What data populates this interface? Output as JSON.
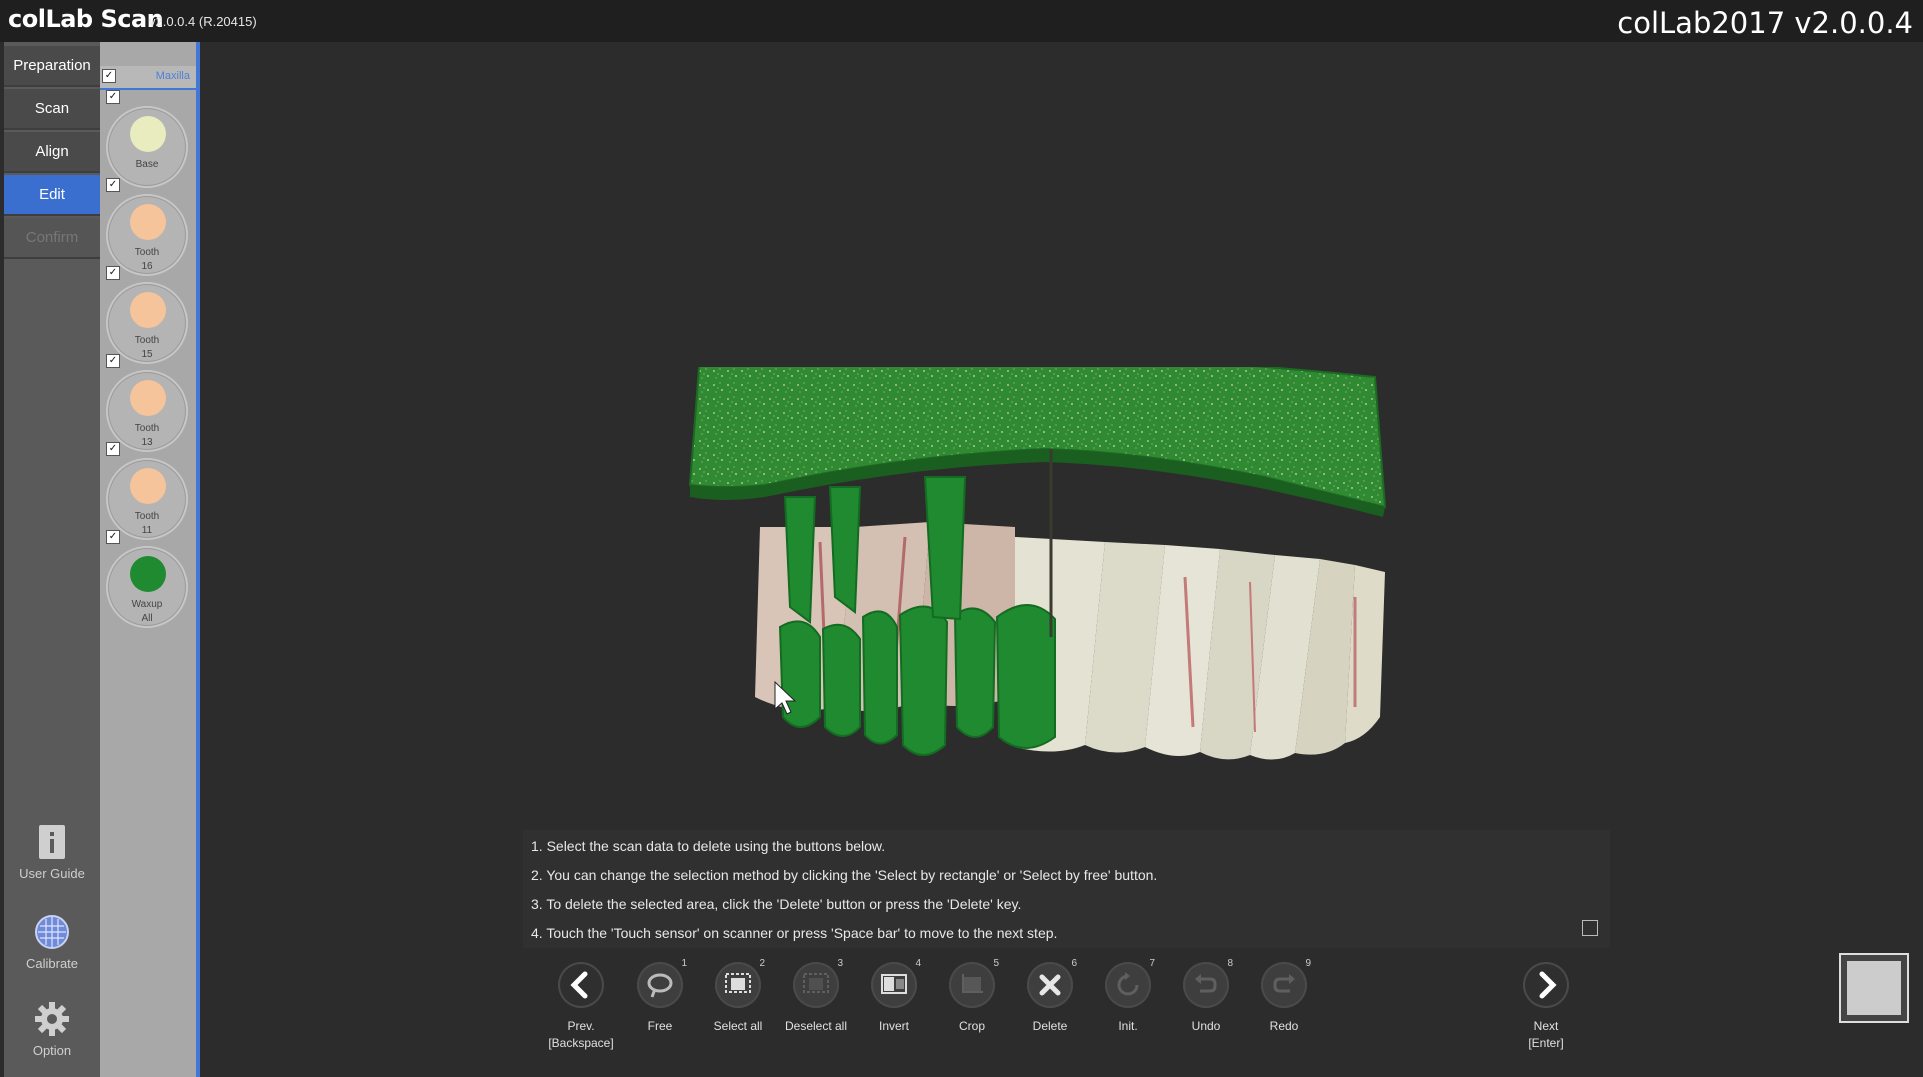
{
  "app": {
    "name": "colLab Scan",
    "version": "v2.0.0.4 (R.20415)",
    "right_title": "colLab2017 v2.0.0.4"
  },
  "nav": {
    "steps": [
      {
        "label": "Preparation",
        "state": "normal"
      },
      {
        "label": "Scan",
        "state": "normal"
      },
      {
        "label": "Align",
        "state": "normal"
      },
      {
        "label": "Edit",
        "state": "active"
      },
      {
        "label": "Confirm",
        "state": "disabled"
      }
    ],
    "bottom": {
      "user_guide": "User Guide",
      "calibrate": "Calibrate",
      "option": "Option"
    }
  },
  "layers": {
    "group_label": "Maxilla",
    "items": [
      {
        "name": "Base",
        "color": "#e8ecbe",
        "checked": true
      },
      {
        "name": "Tooth\n16",
        "color": "#f6c49a",
        "checked": true
      },
      {
        "name": "Tooth\n15",
        "color": "#f6c49a",
        "checked": true
      },
      {
        "name": "Tooth\n13",
        "color": "#f6c49a",
        "checked": true
      },
      {
        "name": "Tooth\n11",
        "color": "#f6c49a",
        "checked": true
      },
      {
        "name": "Waxup\nAll",
        "color": "#1f8a2f",
        "checked": true
      }
    ]
  },
  "instructions": [
    "1. Select the scan data to delete using the buttons below.",
    "2. You can change the selection method by clicking the 'Select by rectangle' or 'Select by free' button.",
    "3. To delete the selected area, click the 'Delete' button or press the 'Delete' key.",
    "4. Touch the 'Touch sensor' on scanner or press 'Space bar' to move to the next step."
  ],
  "toolbar": {
    "prev": "Prev.\n[Backspace]",
    "next": "Next\n[Enter]",
    "tools": [
      {
        "label": "Free",
        "num": "1"
      },
      {
        "label": "Select all",
        "num": "2"
      },
      {
        "label": "Deselect all",
        "num": "3"
      },
      {
        "label": "Invert",
        "num": "4"
      },
      {
        "label": "Crop",
        "num": "5"
      },
      {
        "label": "Delete",
        "num": "6"
      },
      {
        "label": "Init.",
        "num": "7"
      },
      {
        "label": "Undo",
        "num": "8"
      },
      {
        "label": "Redo",
        "num": "9"
      }
    ]
  },
  "colors": {
    "accent": "#3a6fd0",
    "waxup_green": "#1f8a2f",
    "tooth_white": "#e9e7da"
  }
}
